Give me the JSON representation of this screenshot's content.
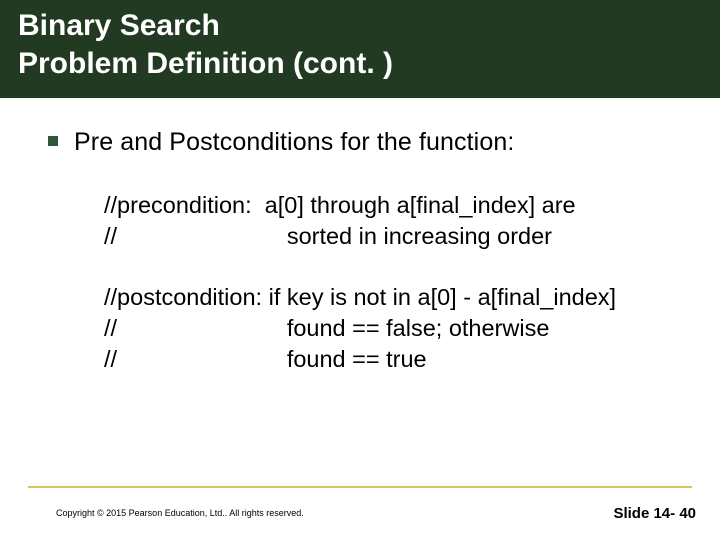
{
  "title": {
    "line1": "Binary Search",
    "line2": "Problem Definition (cont. )"
  },
  "bullet": {
    "text": "Pre and Postconditions for the function:"
  },
  "precond": {
    "l1": "//precondition:  a[0] through a[final_index] are",
    "l2": "//                          sorted in increasing order"
  },
  "postcond": {
    "l1": "//postcondition: if key is not in a[0] - a[final_index]",
    "l2": "//                          found == false; otherwise",
    "l3": "//                          found == true"
  },
  "footer": {
    "copyright": "Copyright © 2015 Pearson Education, Ltd..  All rights reserved.",
    "slidenum": "Slide 14- 40"
  }
}
